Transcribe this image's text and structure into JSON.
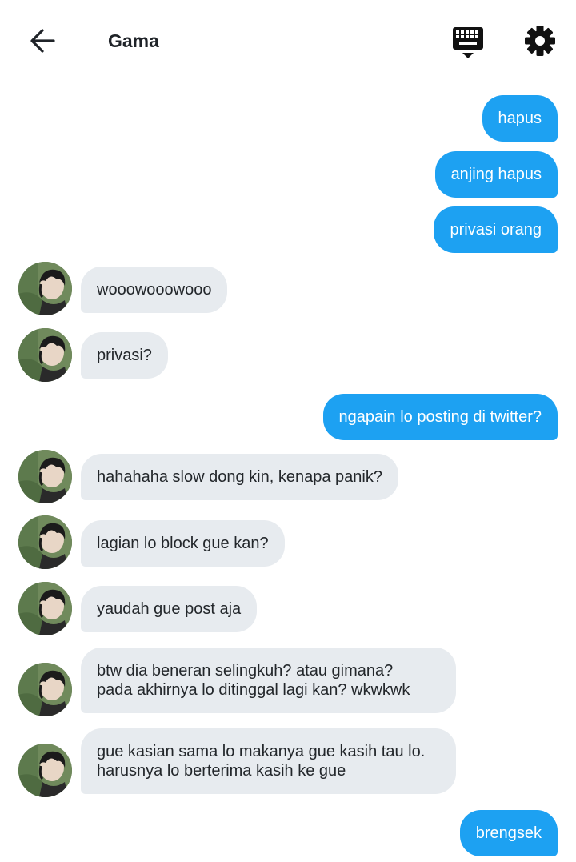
{
  "header": {
    "title": "Gama",
    "back_icon": "arrow-left-icon",
    "keyboard_icon": "keyboard-hide-icon",
    "settings_icon": "gear-icon"
  },
  "colors": {
    "outgoing_bubble": "#1da1f2",
    "incoming_bubble": "#e7ebef"
  },
  "messages": [
    {
      "dir": "out",
      "text": "hapus"
    },
    {
      "dir": "out",
      "text": "anjing hapus"
    },
    {
      "dir": "out",
      "text": "privasi orang"
    },
    {
      "dir": "in",
      "text": "wooowooowooo"
    },
    {
      "dir": "in",
      "text": "privasi?"
    },
    {
      "dir": "out",
      "text": "ngapain lo posting di twitter?"
    },
    {
      "dir": "in",
      "text": "hahahaha slow dong kin, kenapa panik?"
    },
    {
      "dir": "in",
      "text": "lagian lo block gue kan?"
    },
    {
      "dir": "in",
      "text": "yaudah gue post aja"
    },
    {
      "dir": "in",
      "text": "btw dia beneran selingkuh? atau gimana?\npada akhirnya lo ditinggal lagi kan? wkwkwk"
    },
    {
      "dir": "in",
      "text": "gue kasian sama lo makanya gue kasih tau lo.\nharusnya lo berterima kasih ke gue"
    },
    {
      "dir": "out",
      "text": "brengsek"
    }
  ]
}
